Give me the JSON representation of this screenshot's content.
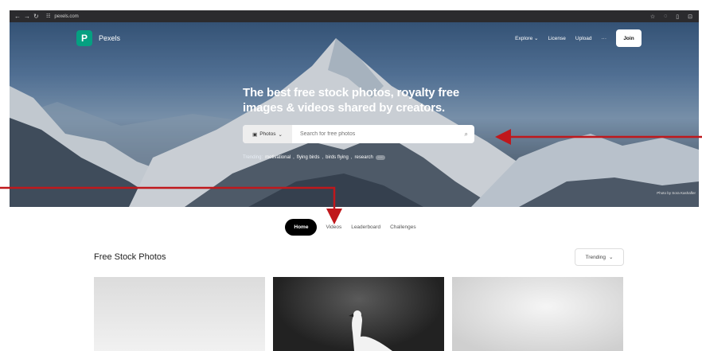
{
  "browser": {
    "nav_icons": [
      "back-icon",
      "forward-icon",
      "reload-icon",
      "site-info-icon"
    ],
    "url": "pexels.com",
    "toolbar_icons": [
      "bookmark-star-icon",
      "extensions-icon",
      "sidebar-icon",
      "profile-icon"
    ]
  },
  "header": {
    "brand_letter": "P",
    "brand": "Pexels",
    "nav": [
      {
        "label": "Explore",
        "has_chevron": true
      },
      {
        "label": "License"
      },
      {
        "label": "Upload"
      },
      {
        "label": "···"
      }
    ],
    "join_label": "Join"
  },
  "hero": {
    "headline": "The best free stock photos, royalty free images & videos shared by creators.",
    "search_type": "Photos",
    "search_placeholder": "Search for free photos",
    "trending_label": "Trending:",
    "trending_terms": [
      "motivational",
      "flying birds",
      "birds flying",
      "research"
    ],
    "trending_more": "···",
    "photo_credit": "Photo by Sora Kashafler"
  },
  "tabs": [
    {
      "label": "Home",
      "active": true
    },
    {
      "label": "Videos",
      "active": false
    },
    {
      "label": "Leaderboard",
      "active": false
    },
    {
      "label": "Challenges",
      "active": false
    }
  ],
  "content": {
    "section_title": "Free Stock Photos",
    "sort_label": "Trending"
  },
  "colors": {
    "brand": "#05a081",
    "annotation_arrow": "#c0181c"
  }
}
